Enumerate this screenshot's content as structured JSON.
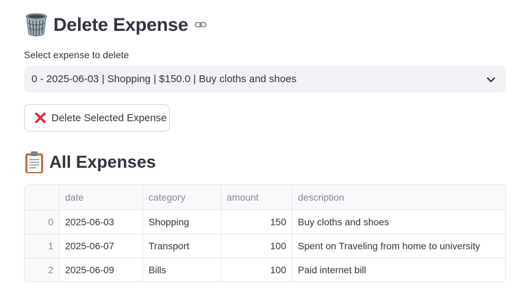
{
  "delete_section": {
    "title": "Delete Expense",
    "select_label": "Select expense to delete",
    "selected_value": "0 - 2025-06-03 | Shopping | $150.0 | Buy cloths and shoes",
    "button_label": "Delete Selected Expense"
  },
  "expenses_section": {
    "title": "All Expenses",
    "columns": [
      "",
      "date",
      "category",
      "amount",
      "description"
    ],
    "rows": [
      {
        "index": "0",
        "date": "2025-06-03",
        "category": "Shopping",
        "amount": "150",
        "description": "Buy cloths and shoes"
      },
      {
        "index": "1",
        "date": "2025-06-07",
        "category": "Transport",
        "amount": "100",
        "description": "Spent on Traveling from home to university"
      },
      {
        "index": "2",
        "date": "2025-06-09",
        "category": "Bills",
        "amount": "100",
        "description": "Paid internet bill"
      }
    ]
  },
  "icons": {
    "title_icon": "wastebasket-icon",
    "anchor_icon": "link-icon",
    "dropdown_icon": "chevron-down-icon",
    "button_icon": "cross-mark-icon",
    "table_title_icon": "clipboard-icon"
  },
  "colors": {
    "text": "#31333f",
    "muted": "#84868f",
    "select_bg": "#f0f2f6",
    "border": "#e6e8ec",
    "cross_red": "#dd2e44"
  }
}
